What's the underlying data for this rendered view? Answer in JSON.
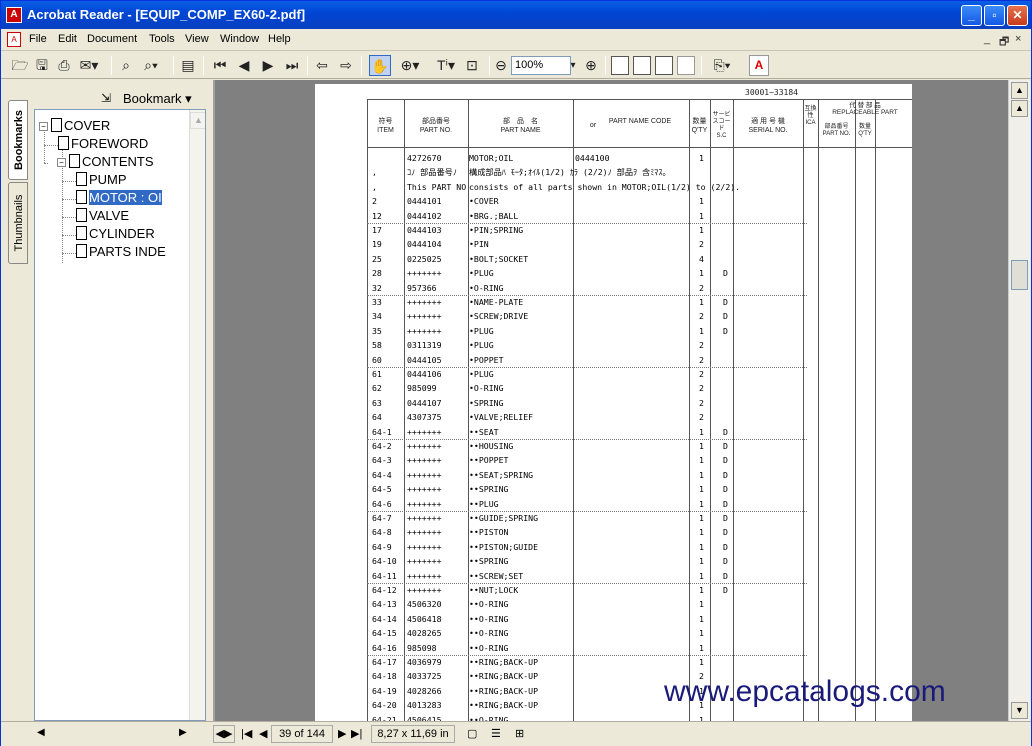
{
  "window": {
    "title": "Acrobat Reader - [EQUIP_COMP_EX60-2.pdf]",
    "app_icon": "acrobat-icon"
  },
  "menu": [
    "File",
    "Edit",
    "Document",
    "Tools",
    "View",
    "Window",
    "Help"
  ],
  "mdi_controls": [
    "_",
    "🗗",
    "×"
  ],
  "toolbar": {
    "zoom": "100%"
  },
  "nav": {
    "tabs": [
      "Bookmarks",
      "Thumbnails"
    ],
    "bookmark_label": "Bookmark ▾",
    "tree": [
      {
        "label": "COVER",
        "level": 0,
        "expander": "-"
      },
      {
        "label": "FOREWORD",
        "level": 1
      },
      {
        "label": "CONTENTS",
        "level": 1,
        "expander": "-"
      },
      {
        "label": "PUMP",
        "level": 2
      },
      {
        "label": "MOTOR : OI",
        "level": 2,
        "selected": true
      },
      {
        "label": "VALVE",
        "level": 2
      },
      {
        "label": "CYLINDER",
        "level": 2
      },
      {
        "label": "PARTS INDE",
        "level": 2
      }
    ]
  },
  "document": {
    "serial_range": "30001~33184",
    "headers": {
      "item_jp": "符号",
      "item_en": "ITEM",
      "partno_jp": "部品番号",
      "partno_en": "PART NO.",
      "partname_jp": "部　品　名",
      "partname_en": "PART NAME",
      "or": "or",
      "code_en": "PART NAME CODE",
      "qty_jp": "数量",
      "qty_en": "Q'TY",
      "sc_jp": "サービスコード",
      "sc_en": "S.C",
      "serial_jp": "適 用 号 機",
      "serial_en": "SERIAL NO.",
      "ica_jp": "互換性",
      "ica_en": "ICA",
      "repl_jp": "代 替 部 品",
      "repl_en": "REPLACEABLE PART",
      "repl_partno": "部品番号 PART NO.",
      "repl_qty": "数量 Q'TY"
    },
    "rows": [
      {
        "item": "",
        "part": "4272670",
        "name": "MOTOR;OIL",
        "code": "0444100",
        "qty": "1",
        "sc": ""
      },
      {
        "item": ",",
        "part": "ｺﾉ 部品番号ﾉ",
        "name": "構成部品ﾊ ﾓｰﾀ;ｵｲﾙ(1/2) ｶﾗ (2/2)ﾉ 部品ｦ 含ﾐﾏｽ。",
        "code": "",
        "qty": "",
        "sc": ""
      },
      {
        "item": ",",
        "part": "This PART NO",
        "name": "consists of all parts shown in MOTOR;OIL(1/2) to (2/2).",
        "code": "",
        "qty": "",
        "sc": ""
      },
      {
        "item": "2",
        "part": "0444101",
        "name": "•COVER",
        "code": "",
        "qty": "1",
        "sc": ""
      },
      {
        "item": "12",
        "part": "0444102",
        "name": "•BRG.;BALL",
        "code": "",
        "qty": "1",
        "sc": ""
      },
      {
        "item": "17",
        "part": "0444103",
        "name": "•PIN;SPRING",
        "code": "",
        "qty": "1",
        "sc": ""
      },
      {
        "item": "19",
        "part": "0444104",
        "name": "•PIN",
        "code": "",
        "qty": "2",
        "sc": ""
      },
      {
        "item": "25",
        "part": "0225025",
        "name": "•BOLT;SOCKET",
        "code": "",
        "qty": "4",
        "sc": ""
      },
      {
        "item": "28",
        "part": "+++++++",
        "name": "•PLUG",
        "code": "",
        "qty": "1",
        "sc": "D"
      },
      {
        "item": "32",
        "part": "957366",
        "name": "•O-RING",
        "code": "",
        "qty": "2",
        "sc": ""
      },
      {
        "item": "33",
        "part": "+++++++",
        "name": "•NAME-PLATE",
        "code": "",
        "qty": "1",
        "sc": "D"
      },
      {
        "item": "34",
        "part": "+++++++",
        "name": "•SCREW;DRIVE",
        "code": "",
        "qty": "2",
        "sc": "D"
      },
      {
        "item": "35",
        "part": "+++++++",
        "name": "•PLUG",
        "code": "",
        "qty": "1",
        "sc": "D"
      },
      {
        "item": "58",
        "part": "0311319",
        "name": "•PLUG",
        "code": "",
        "qty": "2",
        "sc": ""
      },
      {
        "item": "60",
        "part": "0444105",
        "name": "•POPPET",
        "code": "",
        "qty": "2",
        "sc": ""
      },
      {
        "item": "61",
        "part": "0444106",
        "name": "•PLUG",
        "code": "",
        "qty": "2",
        "sc": ""
      },
      {
        "item": "62",
        "part": "985099",
        "name": "•O-RING",
        "code": "",
        "qty": "2",
        "sc": ""
      },
      {
        "item": "63",
        "part": "0444107",
        "name": "•SPRING",
        "code": "",
        "qty": "2",
        "sc": ""
      },
      {
        "item": "64",
        "part": "4307375",
        "name": "•VALVE;RELIEF",
        "code": "",
        "qty": "2",
        "sc": ""
      },
      {
        "item": "64-1",
        "part": "+++++++",
        "name": "••SEAT",
        "code": "",
        "qty": "1",
        "sc": "D"
      },
      {
        "item": "64-2",
        "part": "+++++++",
        "name": "••HOUSING",
        "code": "",
        "qty": "1",
        "sc": "D"
      },
      {
        "item": "64-3",
        "part": "+++++++",
        "name": "••POPPET",
        "code": "",
        "qty": "1",
        "sc": "D"
      },
      {
        "item": "64-4",
        "part": "+++++++",
        "name": "••SEAT;SPRING",
        "code": "",
        "qty": "1",
        "sc": "D"
      },
      {
        "item": "64-5",
        "part": "+++++++",
        "name": "••SPRING",
        "code": "",
        "qty": "1",
        "sc": "D"
      },
      {
        "item": "64-6",
        "part": "+++++++",
        "name": "••PLUG",
        "code": "",
        "qty": "1",
        "sc": "D"
      },
      {
        "item": "64-7",
        "part": "+++++++",
        "name": "••GUIDE;SPRING",
        "code": "",
        "qty": "1",
        "sc": "D"
      },
      {
        "item": "64-8",
        "part": "+++++++",
        "name": "••PISTON",
        "code": "",
        "qty": "1",
        "sc": "D"
      },
      {
        "item": "64-9",
        "part": "+++++++",
        "name": "••PISTON;GUIDE",
        "code": "",
        "qty": "1",
        "sc": "D"
      },
      {
        "item": "64-10",
        "part": "+++++++",
        "name": "••SPRING",
        "code": "",
        "qty": "1",
        "sc": "D"
      },
      {
        "item": "64-11",
        "part": "+++++++",
        "name": "••SCREW;SET",
        "code": "",
        "qty": "1",
        "sc": "D"
      },
      {
        "item": "64-12",
        "part": "+++++++",
        "name": "••NUT;LOCK",
        "code": "",
        "qty": "1",
        "sc": "D"
      },
      {
        "item": "64-13",
        "part": "4506320",
        "name": "••O-RING",
        "code": "",
        "qty": "1",
        "sc": ""
      },
      {
        "item": "64-14",
        "part": "4506418",
        "name": "••O-RING",
        "code": "",
        "qty": "1",
        "sc": ""
      },
      {
        "item": "64-15",
        "part": "4028265",
        "name": "••O-RING",
        "code": "",
        "qty": "1",
        "sc": ""
      },
      {
        "item": "64-16",
        "part": "985098",
        "name": "••O-RING",
        "code": "",
        "qty": "1",
        "sc": ""
      },
      {
        "item": "64-17",
        "part": "4036979",
        "name": "••RING;BACK-UP",
        "code": "",
        "qty": "1",
        "sc": ""
      },
      {
        "item": "64-18",
        "part": "4033725",
        "name": "••RING;BACK-UP",
        "code": "",
        "qty": "2",
        "sc": ""
      },
      {
        "item": "64-19",
        "part": "4028266",
        "name": "••RING;BACK-UP",
        "code": "",
        "qty": "1",
        "sc": ""
      },
      {
        "item": "64-20",
        "part": "4013283",
        "name": "••RING;BACK-UP",
        "code": "",
        "qty": "1",
        "sc": ""
      },
      {
        "item": "64-21",
        "part": "4506415",
        "name": "••O-RING",
        "code": "",
        "qty": "1",
        "sc": ""
      }
    ],
    "separators_after": [
      4,
      9,
      14,
      19,
      24,
      29,
      34
    ]
  },
  "watermark": "www.epcatalogs.com",
  "status": {
    "page": "39 of 144",
    "size": "8,27 x 11,69 in"
  }
}
